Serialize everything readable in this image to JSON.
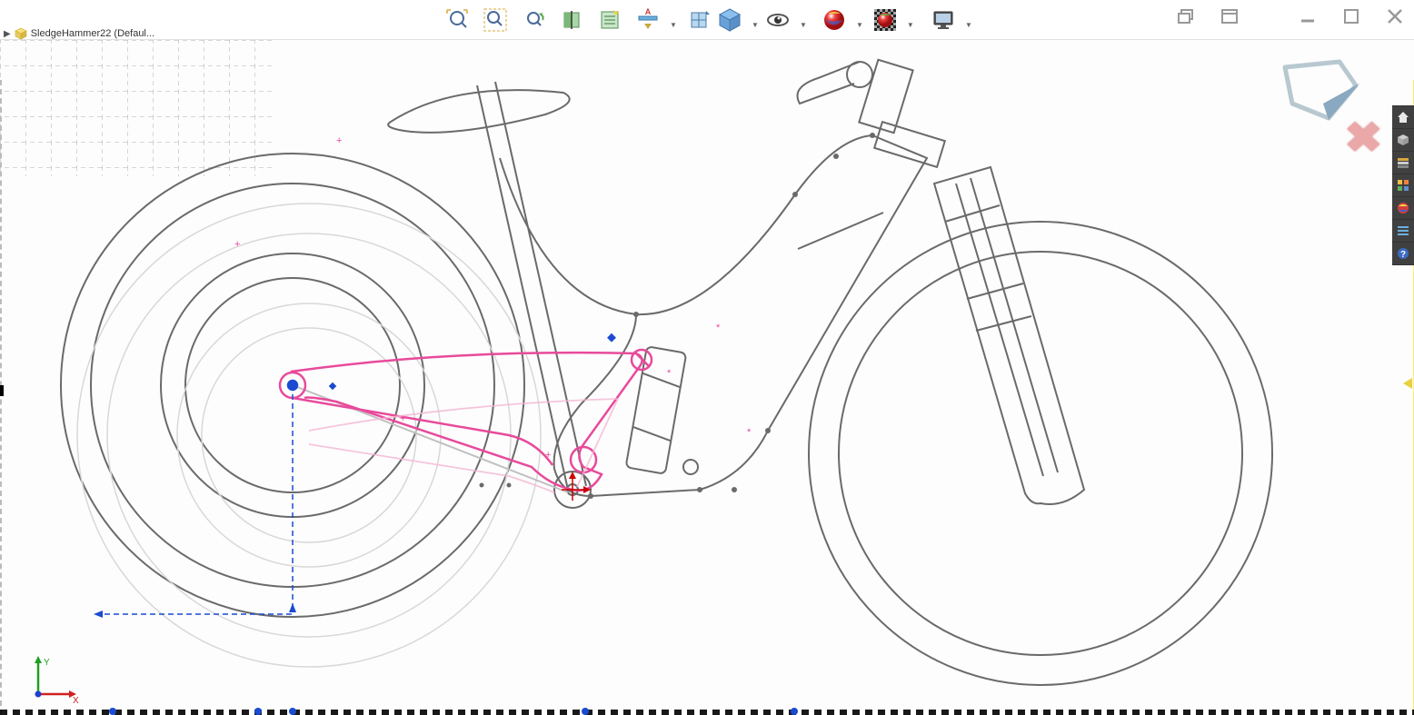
{
  "tree": {
    "root_label": "SledgeHammer22 (Defaul..."
  },
  "toolbar": {
    "zoom_fit": "Zoom to Fit",
    "zoom_area": "Zoom to Area",
    "prev_view": "Previous View",
    "section": "Section View",
    "deferred": "Dynamic Annotation Views",
    "display_style": "Display Style",
    "view_orient": "View Orientation",
    "hide_show": "Hide/Show Items",
    "appearance": "Edit Appearance",
    "scene": "Apply Scene",
    "view_settings": "View Settings"
  },
  "window": {
    "restore": "Restore Document Window",
    "arrange": "Arrange Windows",
    "minimize": "Minimize",
    "maximize": "Maximize",
    "close": "Close"
  },
  "right_panel": {
    "home": "Home",
    "geometry": "Geometry",
    "layers": "Layers",
    "presets": "Presets",
    "appearances": "Appearances",
    "options": "Options",
    "help": "Help"
  },
  "axes": {
    "x": "X",
    "y": "Y"
  },
  "colors": {
    "grid": "#b0b0b0",
    "sketch_gray": "#6a6a6a",
    "sketch_light": "#c8c8c8",
    "highlight": "#e84a9b",
    "constraint_blue": "#1a4bd1",
    "close_x": "#eaa8a8",
    "confirm_arrow": "#8aa8c0"
  }
}
